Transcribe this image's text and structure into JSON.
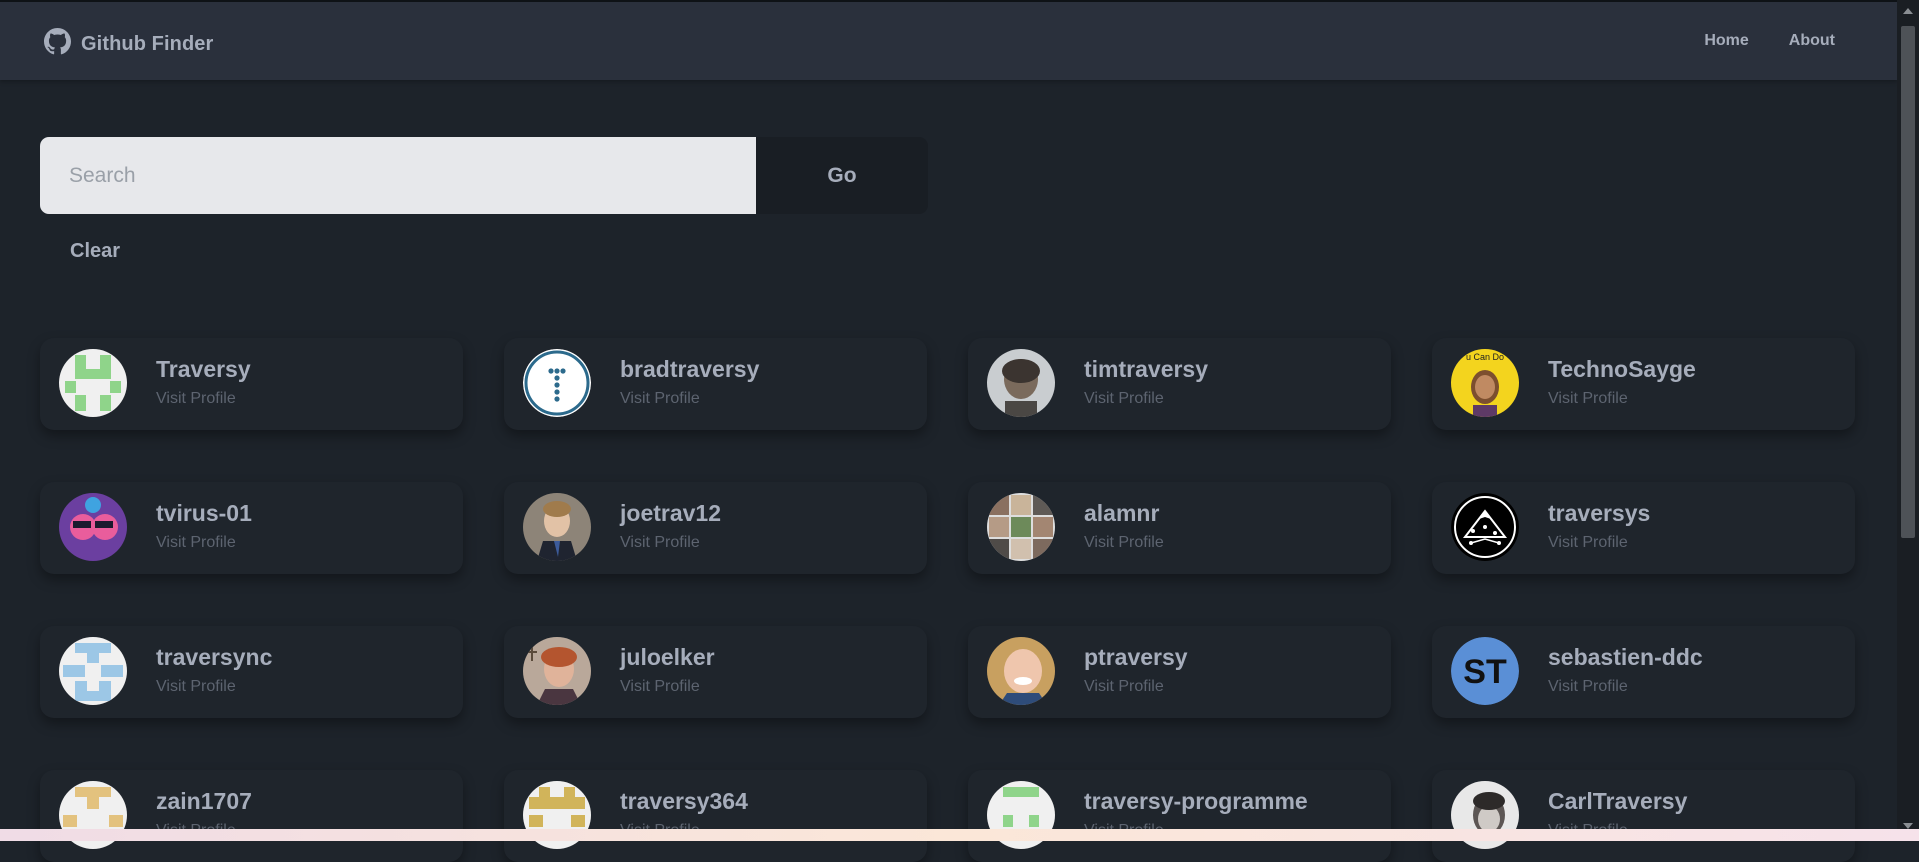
{
  "app": {
    "title": "Github Finder"
  },
  "nav": {
    "items": [
      {
        "label": "Home"
      },
      {
        "label": "About"
      }
    ]
  },
  "search": {
    "placeholder": "Search",
    "value": "",
    "go_label": "Go",
    "clear_label": "Clear"
  },
  "users": [
    {
      "login": "Traversy",
      "link_label": "Visit Profile",
      "avatar": "identicon-green"
    },
    {
      "login": "bradtraversy",
      "link_label": "Visit Profile",
      "avatar": "logo-t-blue"
    },
    {
      "login": "timtraversy",
      "link_label": "Visit Profile",
      "avatar": "photo-portrait"
    },
    {
      "login": "TechnoSayge",
      "link_label": "Visit Profile",
      "avatar": "cartoon-yellow"
    },
    {
      "login": "tvirus-01",
      "link_label": "Visit Profile",
      "avatar": "cartoon-purple"
    },
    {
      "login": "joetrav12",
      "link_label": "Visit Profile",
      "avatar": "photo-portrait"
    },
    {
      "login": "alamnr",
      "link_label": "Visit Profile",
      "avatar": "photo-collage"
    },
    {
      "login": "traversys",
      "link_label": "Visit Profile",
      "avatar": "mountain-logo"
    },
    {
      "login": "traversync",
      "link_label": "Visit Profile",
      "avatar": "identicon-blue"
    },
    {
      "login": "juloelker",
      "link_label": "Visit Profile",
      "avatar": "photo-portrait"
    },
    {
      "login": "ptraversy",
      "link_label": "Visit Profile",
      "avatar": "photo-portrait"
    },
    {
      "login": "sebastien-ddc",
      "link_label": "Visit Profile",
      "avatar": "initials-st"
    },
    {
      "login": "zain1707",
      "link_label": "Visit Profile",
      "avatar": "identicon-tan"
    },
    {
      "login": "traversy364",
      "link_label": "Visit Profile",
      "avatar": "identicon-gold"
    },
    {
      "login": "traversy-programme",
      "link_label": "Visit Profile",
      "avatar": "identicon-green"
    },
    {
      "login": "CarlTraversy",
      "link_label": "Visit Profile",
      "avatar": "photo-portrait"
    }
  ],
  "colors": {
    "background": "#1d232a",
    "navbar": "#2a303c",
    "card": "#1f252c",
    "text": "#a6adbb",
    "muted": "#5d6470"
  },
  "avatar_initials": "ST",
  "technosayge_banner": "u Can Do"
}
